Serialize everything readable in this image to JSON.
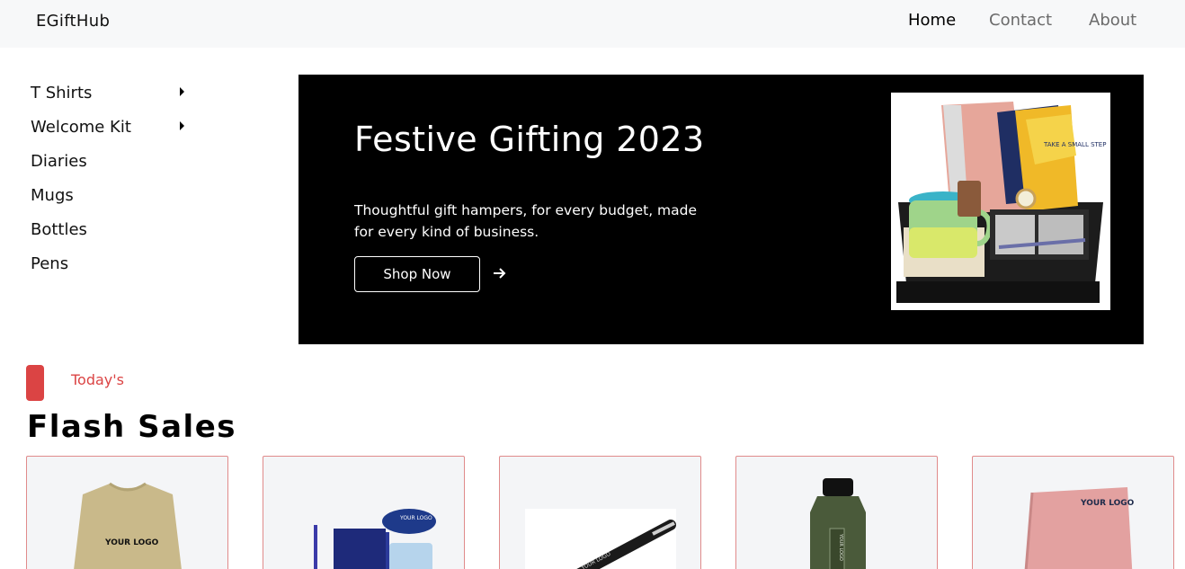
{
  "brand": {
    "name": "EGiftHub"
  },
  "nav": {
    "home": "Home",
    "contact": "Contact",
    "about": "About"
  },
  "sidebar": {
    "items": [
      {
        "label": "T Shirts",
        "has_submenu": true
      },
      {
        "label": "Welcome Kit",
        "has_submenu": true
      },
      {
        "label": "Diaries",
        "has_submenu": false
      },
      {
        "label": "Mugs",
        "has_submenu": false
      },
      {
        "label": "Bottles",
        "has_submenu": false
      },
      {
        "label": "Pens",
        "has_submenu": false
      }
    ]
  },
  "banner": {
    "title": "Festive Gifting 2023",
    "subtitle": "Thoughtful gift hampers, for every budget, made for every kind of business.",
    "cta_label": "Shop Now",
    "image_text": "TAKE A SMALL STEP"
  },
  "flash_sales": {
    "eyebrow": "Today's",
    "title": "Flash Sales",
    "products": [
      {
        "kind": "tshirt",
        "imprint": "YOUR LOGO"
      },
      {
        "kind": "welcome-kit",
        "imprint": "YOUR LOGO"
      },
      {
        "kind": "pen",
        "imprint": "YOUR LOGO"
      },
      {
        "kind": "bottle",
        "imprint": "YOUR LOGO"
      },
      {
        "kind": "diary",
        "imprint": "YOUR LOGO"
      }
    ]
  },
  "colors": {
    "accent": "#db4444",
    "navbar_bg": "#f7f8f9",
    "banner_bg": "#000000"
  },
  "icons": {
    "submenu": "caret-right-icon",
    "cta": "arrow-right-icon"
  }
}
